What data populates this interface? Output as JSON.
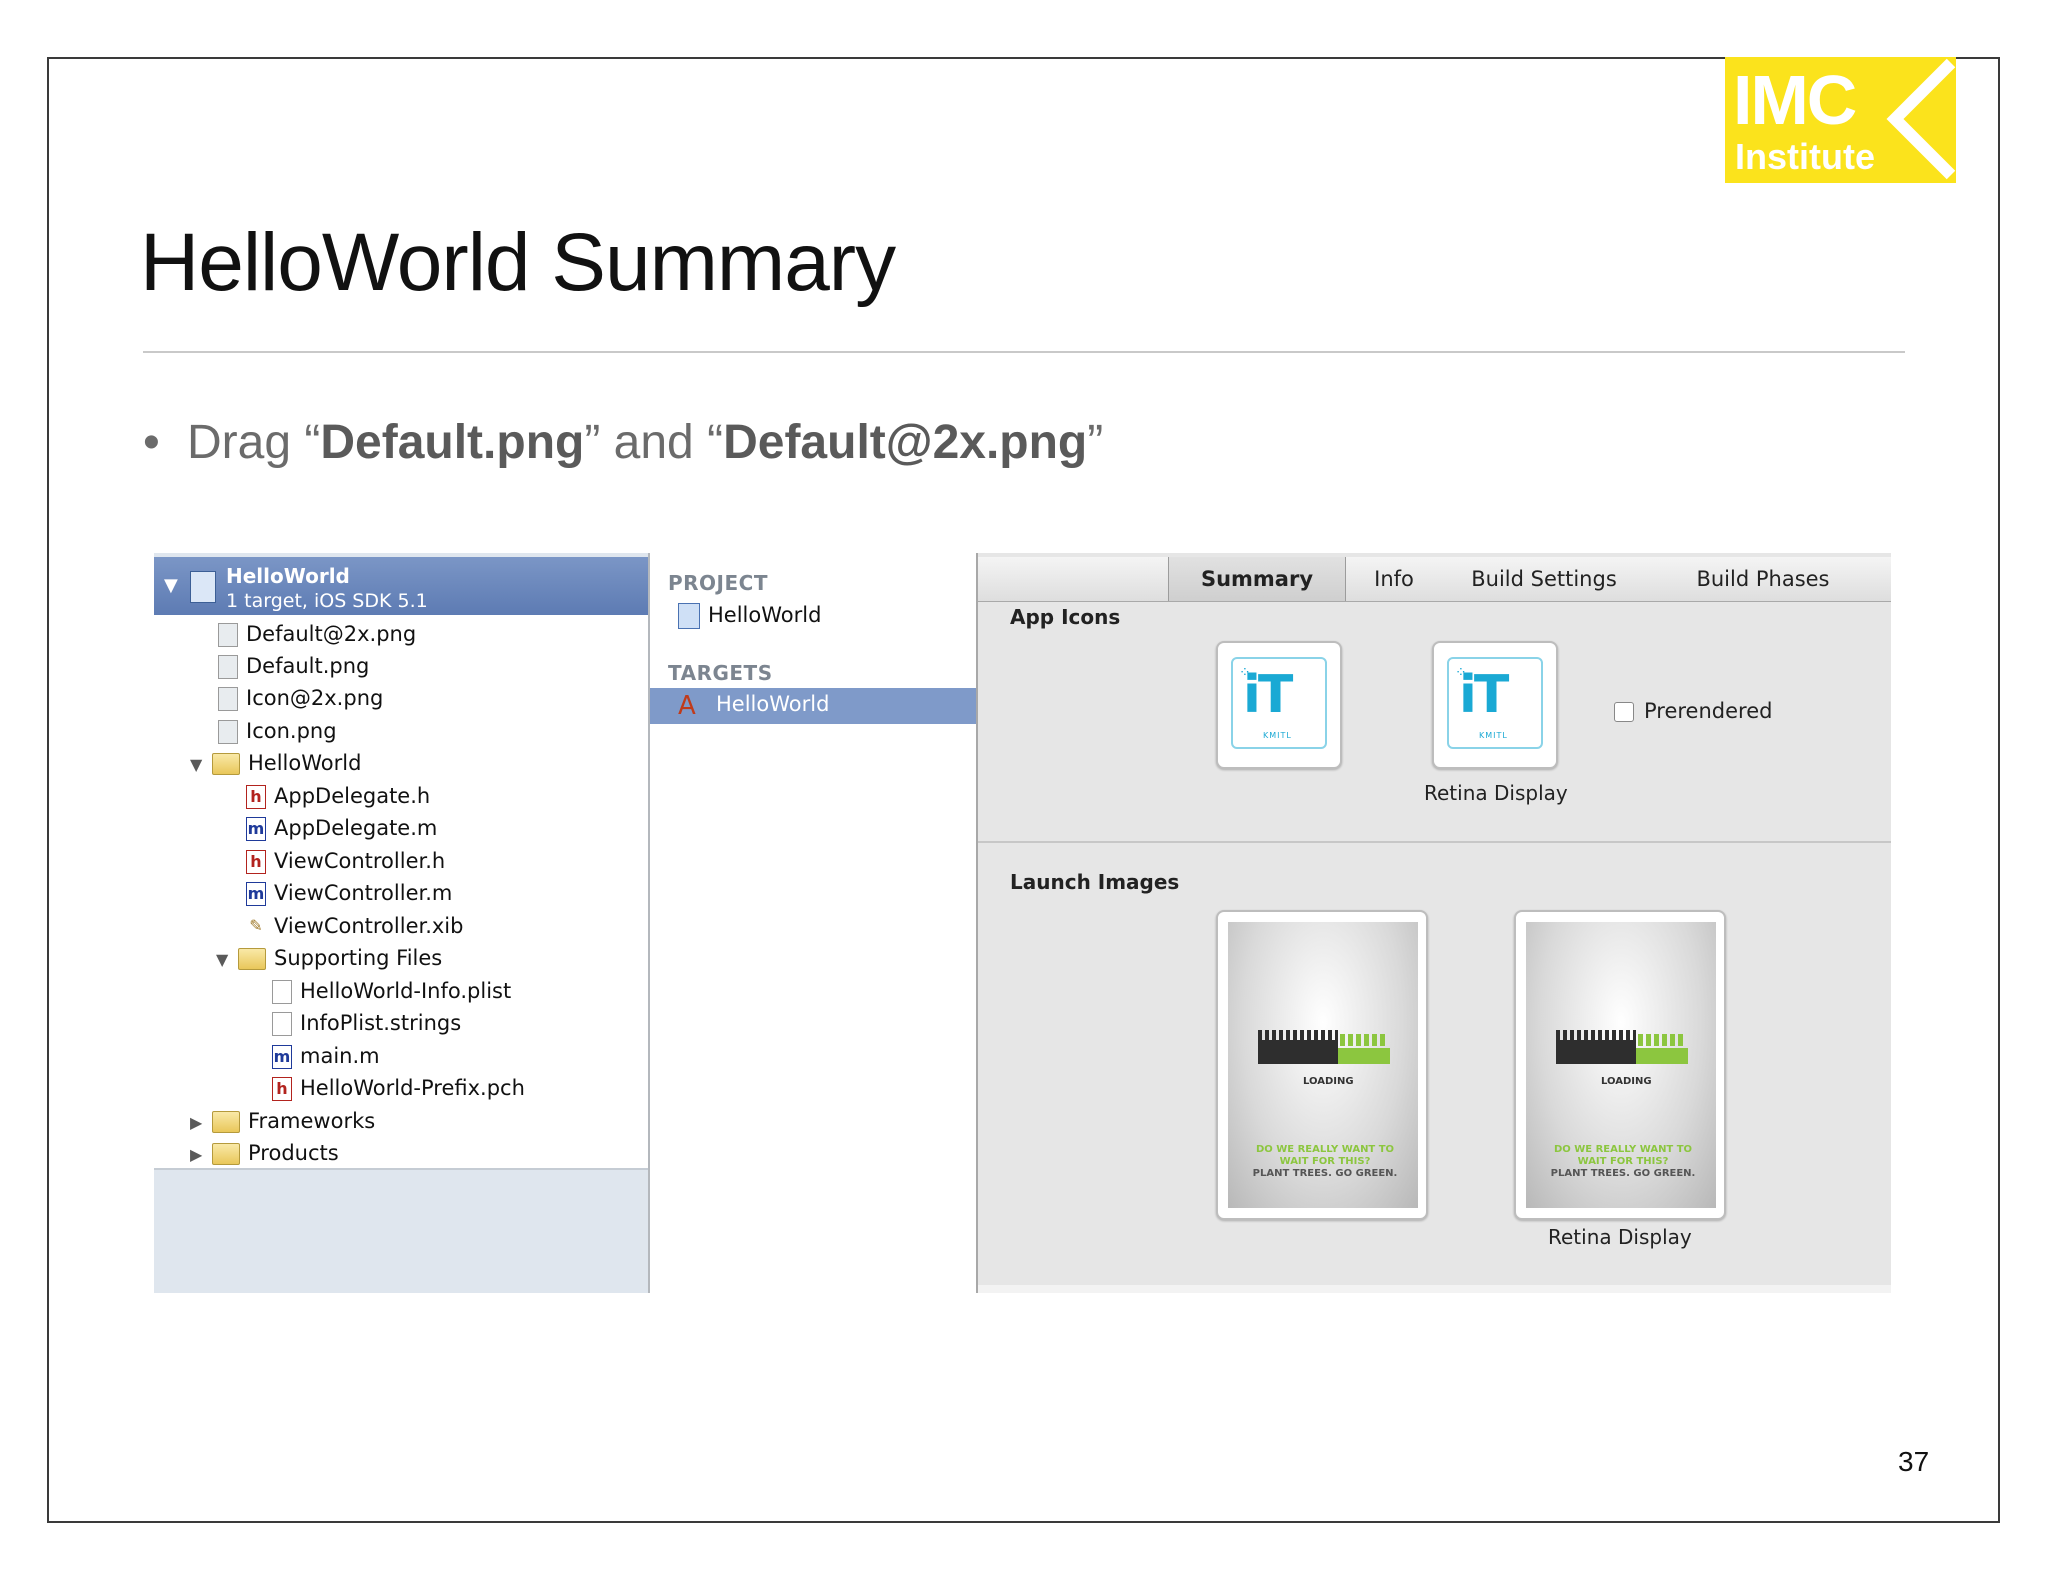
{
  "slide": {
    "title": "HelloWorld Summary",
    "bullet": {
      "prefix": "Drag “",
      "file1": "Default.png",
      "middle": "” and “",
      "file2": "Default@2x.png",
      "suffix": "”"
    },
    "page_number": "37",
    "logo": {
      "line1": "IMC",
      "line2": "Institute",
      "color": "#fbe31c"
    }
  },
  "navigator": {
    "project": {
      "name": "HelloWorld",
      "subtitle": "1 target, iOS SDK 5.1"
    },
    "items": [
      {
        "label": "Default@2x.png",
        "icon": "image-file-icon"
      },
      {
        "label": "Default.png",
        "icon": "image-file-icon"
      },
      {
        "label": "Icon@2x.png",
        "icon": "image-file-icon"
      },
      {
        "label": "Icon.png",
        "icon": "image-file-icon"
      },
      {
        "label": "HelloWorld",
        "icon": "folder-icon",
        "expanded": true
      },
      {
        "label": "AppDelegate.h",
        "icon": "header-file-icon"
      },
      {
        "label": "AppDelegate.m",
        "icon": "source-file-icon"
      },
      {
        "label": "ViewController.h",
        "icon": "header-file-icon"
      },
      {
        "label": "ViewController.m",
        "icon": "source-file-icon"
      },
      {
        "label": "ViewController.xib",
        "icon": "xib-file-icon"
      },
      {
        "label": "Supporting Files",
        "icon": "folder-icon",
        "expanded": true
      },
      {
        "label": "HelloWorld-Info.plist",
        "icon": "plist-file-icon"
      },
      {
        "label": "InfoPlist.strings",
        "icon": "strings-file-icon"
      },
      {
        "label": "main.m",
        "icon": "source-file-icon"
      },
      {
        "label": "HelloWorld-Prefix.pch",
        "icon": "header-file-icon"
      },
      {
        "label": "Frameworks",
        "icon": "folder-icon",
        "expanded": false
      },
      {
        "label": "Products",
        "icon": "folder-icon",
        "expanded": false
      }
    ]
  },
  "middle": {
    "project_section": "PROJECT",
    "project_item": "HelloWorld",
    "targets_section": "TARGETS",
    "target_item": "HelloWorld"
  },
  "editor": {
    "tabs": [
      "Summary",
      "Info",
      "Build Settings",
      "Build Phases"
    ],
    "selected_tab": "Summary",
    "app_icons_label": "App Icons",
    "retina_caption": "Retina Display",
    "prerendered_label": "Prerendered",
    "prerendered_checked": false,
    "launch_images_label": "Launch Images",
    "launch_retina_caption": "Retina Display",
    "icon_art": {
      "logo_text": "iT",
      "logo_sub": "KMITL"
    },
    "launch_art": {
      "loading": "LOADING",
      "tagline_line1": "DO WE REALLY WANT TO WAIT FOR THIS?",
      "tagline_line2": "PLANT TREES. GO GREEN."
    }
  }
}
